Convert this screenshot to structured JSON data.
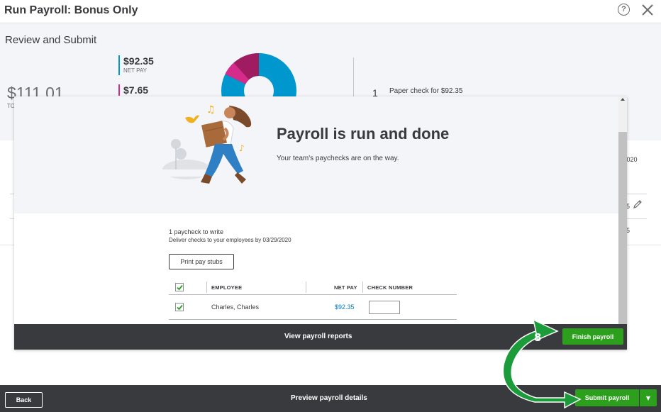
{
  "window": {
    "title": "Run Payroll: Bonus Only",
    "help_glyph": "?"
  },
  "summary": {
    "heading": "Review and Submit",
    "total_amount": "$111.01",
    "total_label": "TO",
    "net_pay": {
      "value": "$92.35",
      "label": "NET PAY",
      "color": "#0097cf"
    },
    "taxes": {
      "value": "$7.65",
      "color": "#d52b8b"
    },
    "other_color": "#9e1c5f",
    "paper_check_count": "1",
    "paper_check_text": "Paper check for $92.35"
  },
  "background_table": {
    "date_fragment": "/2020",
    "cell_a": "5",
    "cell_b": "5"
  },
  "modal": {
    "title": "Payroll is run and done",
    "subtitle": "Your team's paychecks are on the way.",
    "paycheck_count": "1 paycheck to write",
    "deliver_note": "Deliver checks to your employees by 03/29/2020",
    "print_button": "Print pay stubs",
    "table": {
      "headers": {
        "employee": "EMPLOYEE",
        "net_pay": "NET PAY",
        "check_number": "CHECK NUMBER"
      },
      "rows": [
        {
          "employee": "Charles, Charles",
          "net_pay": "$92.35",
          "check_number": ""
        }
      ]
    },
    "footer_link": "View payroll reports",
    "finish_button": "Finish payroll"
  },
  "footer": {
    "back_button": "Back",
    "preview_link": "Preview payroll details",
    "submit_button": "Submit payroll",
    "submit_arrow": "▼"
  },
  "annotation": {
    "step_number": "8",
    "arrow_color": "#1c9b3a"
  },
  "colors": {
    "brand_green": "#2ca01c",
    "dark_footer": "#393a3d",
    "link_blue": "#0077c5"
  }
}
